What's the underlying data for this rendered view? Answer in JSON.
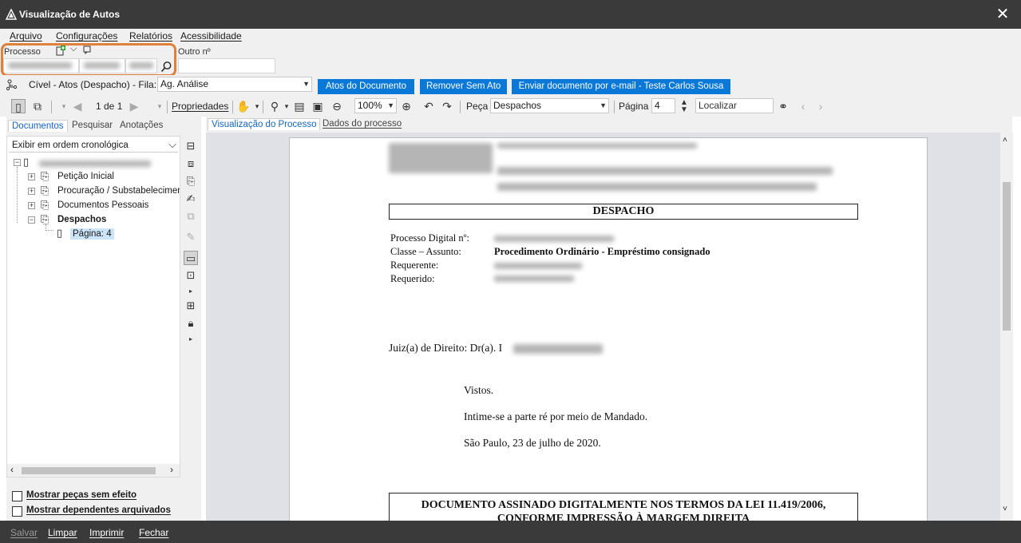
{
  "window": {
    "title": "Visualização de Autos",
    "close_glyph": "✕"
  },
  "menu": [
    "Arquivo",
    "Configurações",
    "Relatórios",
    "Acessibilidade"
  ],
  "process": {
    "label": "Processo",
    "other_label": "Outro nº"
  },
  "row1": {
    "classification": "Cível - Atos (Despacho) - Fila:",
    "queue_value": "Ag. Análise",
    "buttons": [
      "Atos do Documento",
      "Remover Sem Ato",
      "Enviar documento por e-mail - Teste Carlos Sousa"
    ]
  },
  "row2": {
    "page_of": "1 de 1",
    "properties": "Propriedades",
    "zoom": "100%",
    "peca_label": "Peça",
    "peca_value": "Despachos",
    "pagina_label": "Página",
    "pagina_value": "4",
    "localizar_placeholder": "Localizar"
  },
  "left_tabs": [
    "Documentos",
    "Pesquisar",
    "Anotações"
  ],
  "order_select": "Exibir em ordem cronológica",
  "tree": [
    {
      "label": "Petição Inicial"
    },
    {
      "label": "Procuração / Substabelecimento"
    },
    {
      "label": "Documentos Pessoais"
    },
    {
      "label": "Despachos"
    },
    {
      "label": "Página: 4"
    }
  ],
  "checkboxes": [
    "Mostrar peças sem efeito",
    "Mostrar dependentes arquivados"
  ],
  "viewer_tabs": [
    "Visualização do Processo",
    "Dados do processo"
  ],
  "document": {
    "heading": "DESPACHO",
    "fields": [
      {
        "label": "Processo Digital nº:",
        "value": ""
      },
      {
        "label": "Classe – Assunto:",
        "value": "Procedimento Ordinário - Empréstimo consignado"
      },
      {
        "label": "Requerente:",
        "value": ""
      },
      {
        "label": "Requerido:",
        "value": ""
      }
    ],
    "judge": "Juiz(a) de Direito: Dr(a). I",
    "p1": "Vistos.",
    "p2": "Intime-se a parte ré por meio de Mandado.",
    "p3": "São Paulo, 23 de julho de 2020.",
    "footer_line1": "DOCUMENTO ASSINADO DIGITALMENTE NOS TERMOS DA LEI 11.419/2006,",
    "footer_line2": "CONFORME IMPRESSÃO À MARGEM DIREITA"
  },
  "status": [
    "Salvar",
    "Limpar",
    "Imprimir",
    "Fechar"
  ],
  "colors": {
    "accent": "#0a78d7",
    "highlight": "#e0803a",
    "titlebar": "#3a3a3a"
  }
}
